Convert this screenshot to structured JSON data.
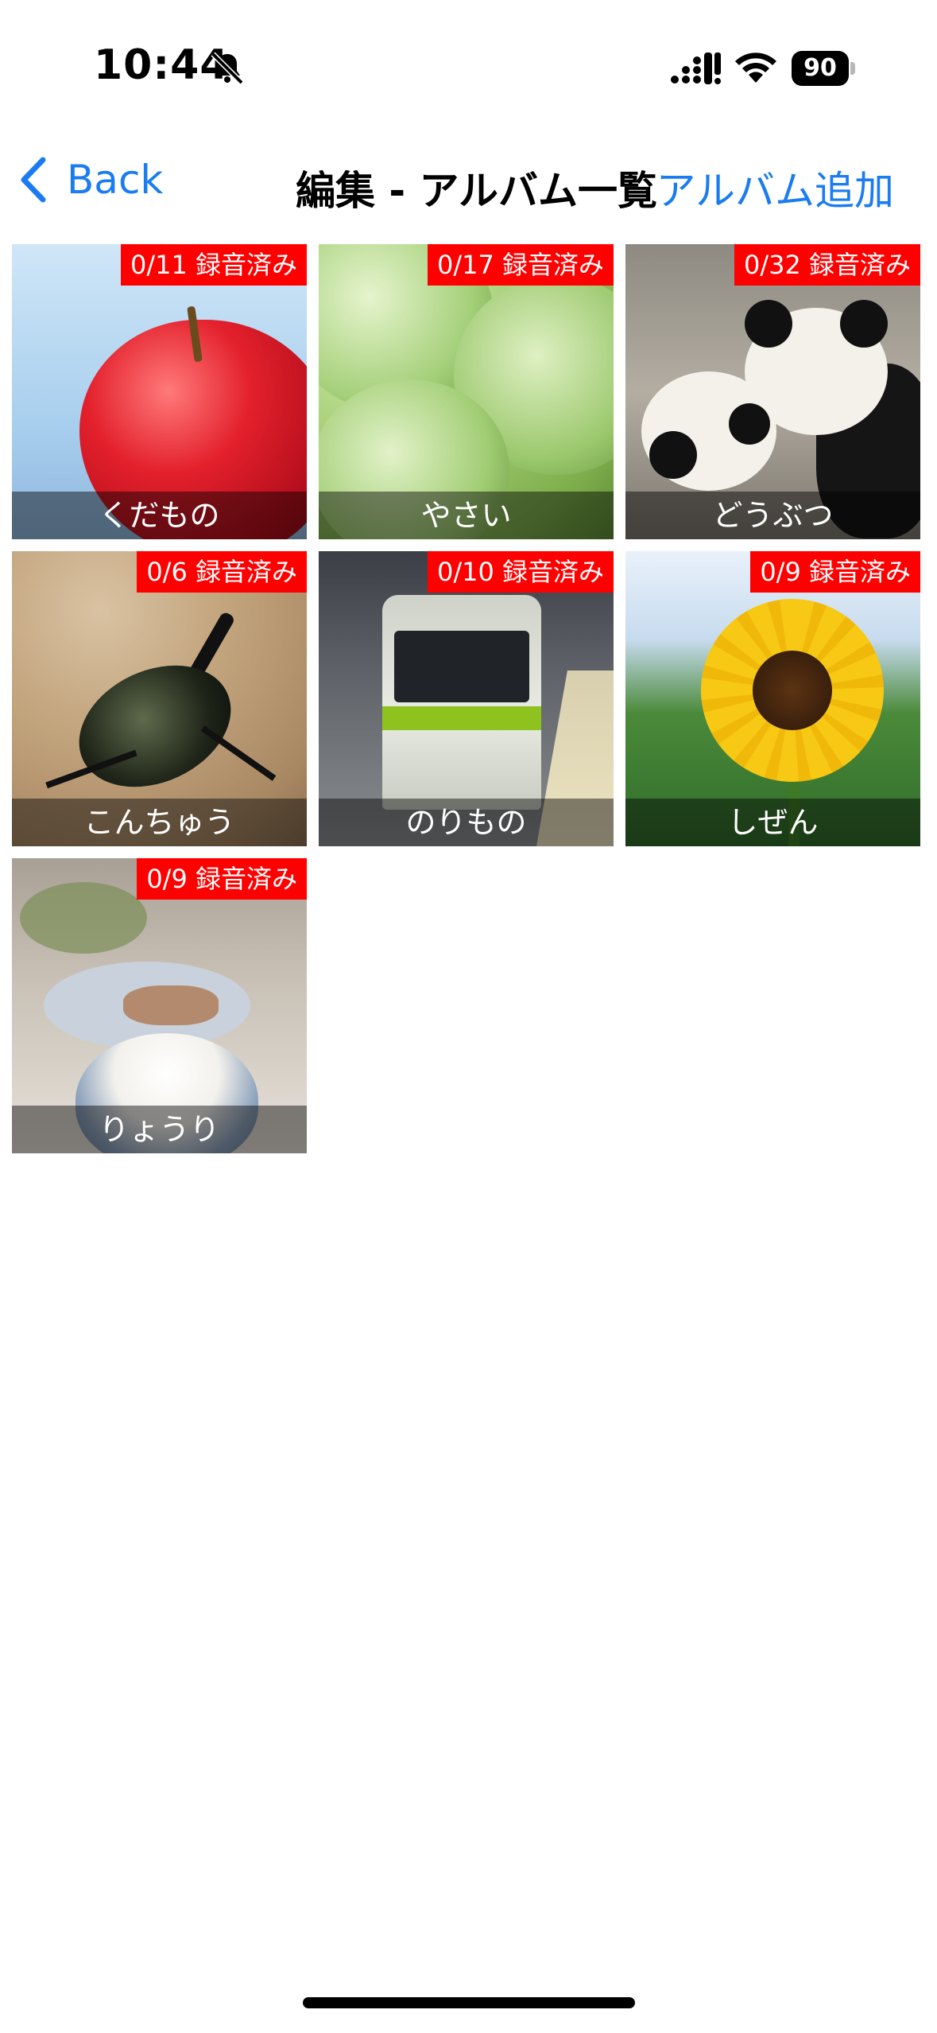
{
  "status_bar": {
    "time": "10:44",
    "battery_level": "90",
    "icons": [
      "bell-slash-icon",
      "cellular-signal-icon",
      "wifi-icon",
      "battery-icon"
    ]
  },
  "nav": {
    "back_label": "Back",
    "title": "編集 - アルバム一覧",
    "add_label": "アルバム追加",
    "accent_color": "#1a7cf0"
  },
  "albums": [
    {
      "name": "くだもの",
      "badge": "0/11 録音済み",
      "image": "apple"
    },
    {
      "name": "やさい",
      "badge": "0/17 録音済み",
      "image": "cabbage"
    },
    {
      "name": "どうぶつ",
      "badge": "0/32 録音済み",
      "image": "pandas"
    },
    {
      "name": "こんちゅう",
      "badge": "0/6 録音済み",
      "image": "beetle"
    },
    {
      "name": "のりもの",
      "badge": "0/10 録音済み",
      "image": "train"
    },
    {
      "name": "しぜん",
      "badge": "0/9 録音済み",
      "image": "sunflower"
    },
    {
      "name": "りょうり",
      "badge": "0/9 録音済み",
      "image": "rice-meal"
    }
  ],
  "badge_color": "#ff0000"
}
